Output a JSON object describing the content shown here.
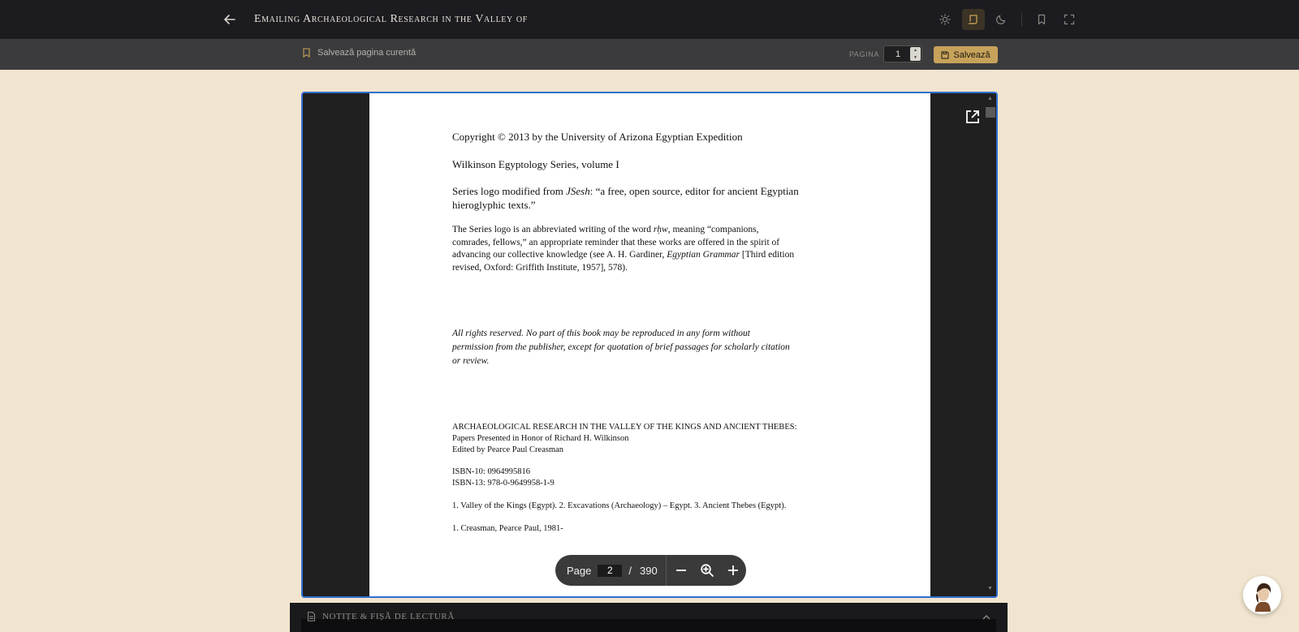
{
  "topbar": {
    "title": "Emailing Archaeological Research in the Valley of",
    "icons": [
      "arrow-left-icon",
      "sun-icon",
      "scroll-icon",
      "moon-icon",
      "bookmark-icon",
      "fullscreen-icon"
    ],
    "active_color": "#c7a25a"
  },
  "subbar": {
    "save_current_label": "Salvează pagina curentă",
    "page_label": "PAGINA",
    "page_value": "1",
    "save_button_label": "Salvează"
  },
  "pdf": {
    "lines": {
      "copyright": "Copyright © 2013 by the University of Arizona Egyptian Expedition",
      "series": "Wilkinson Egyptology Series, volume I",
      "logo_a_pre": "Series logo modified from ",
      "logo_a_it": "JSesh",
      "logo_a_post": ": “a free, open source, editor for ancient Egyptian",
      "logo_b": "hieroglyphic texts.”",
      "p1_a_pre": "The Series logo is an abbreviated writing of the word ",
      "p1_a_it": "rḥw",
      "p1_a_post": ", meaning “companions,",
      "p1_b": "comrades, fellows,” an appropriate reminder that these works are offered in the spirit of",
      "p1_c_pre": "advancing our collective knowledge (see A. H. Gardiner, ",
      "p1_c_it": "Egyptian Grammar",
      "p1_c_post": " [Third edition",
      "p1_d": "revised, Oxford: Griffith Institute, 1957], 578).",
      "rights_a": "All rights reserved. No part of this book may be reproduced in any form without",
      "rights_b": "permission from the publisher, except for quotation of brief passages for scholarly citation",
      "rights_c": "or review.",
      "cat_a": "ARCHAEOLOGICAL RESEARCH IN THE VALLEY OF THE KINGS AND ANCIENT THEBES:",
      "cat_b": "Papers Presented in Honor of Richard H. Wilkinson",
      "cat_c": "Edited by Pearce Paul Creasman",
      "isbn10": "ISBN-10: 0964995816",
      "isbn13": "ISBN-13: 978-0-9649958-1-9",
      "subjects": "1. Valley of the Kings (Egypt).  2. Excavations (Archaeology) – Egypt.  3. Ancient Thebes (Egypt).",
      "author": "1. Creasman, Pearce Paul, 1981-"
    },
    "toolbar": {
      "page_label": "Page",
      "current_page": "2",
      "separator": "/",
      "total_pages": "390"
    }
  },
  "notes": {
    "label": "NOTIȚE & FIȘĂ DE LECTURĂ"
  }
}
